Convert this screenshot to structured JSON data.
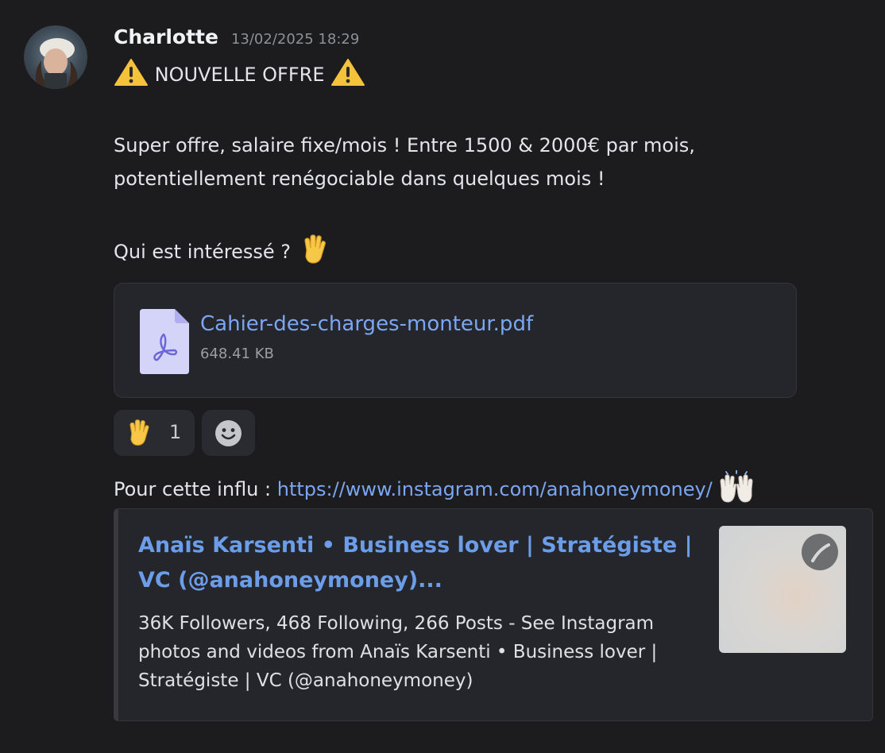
{
  "message": {
    "author": "Charlotte",
    "timestamp": "13/02/2025 18:29",
    "line1": "NOUVELLE OFFRE",
    "line2": "Super offre, salaire fixe/mois ! Entre 1500 & 2000€ par mois,",
    "line3": "potentiellement renégociable dans quelques mois !",
    "line4": "Qui est intéressé ?",
    "icons": [
      "warning-icon",
      "raised-hand-icon"
    ]
  },
  "attachment": {
    "file_name": "Cahier-des-charges-monteur.pdf",
    "file_size": "648.41 KB",
    "icon": "pdf-file-icon"
  },
  "reactions": [
    {
      "emoji": "raised-hand-icon",
      "count": "1"
    },
    {
      "emoji": "add-reaction-smiley-icon"
    }
  ],
  "followup": {
    "prefix": "Pour cette influ : ",
    "url": "https://www.instagram.com/anahoneymoney/",
    "icon": "raising-hands-icon"
  },
  "embed": {
    "title": "Anaïs Karsenti • Business lover | Stratégiste | VC (@anahoneymoney)...",
    "description": "36K Followers, 468 Following, 266 Posts - See Instagram photos and videos from Anaïs Karsenti • Business lover | Stratégiste | VC (@anahoneymoney)"
  },
  "colors": {
    "background": "#1c1c1f",
    "link": "#7aa6f2",
    "embed_title": "#6c9de8",
    "card": "#25262b"
  }
}
